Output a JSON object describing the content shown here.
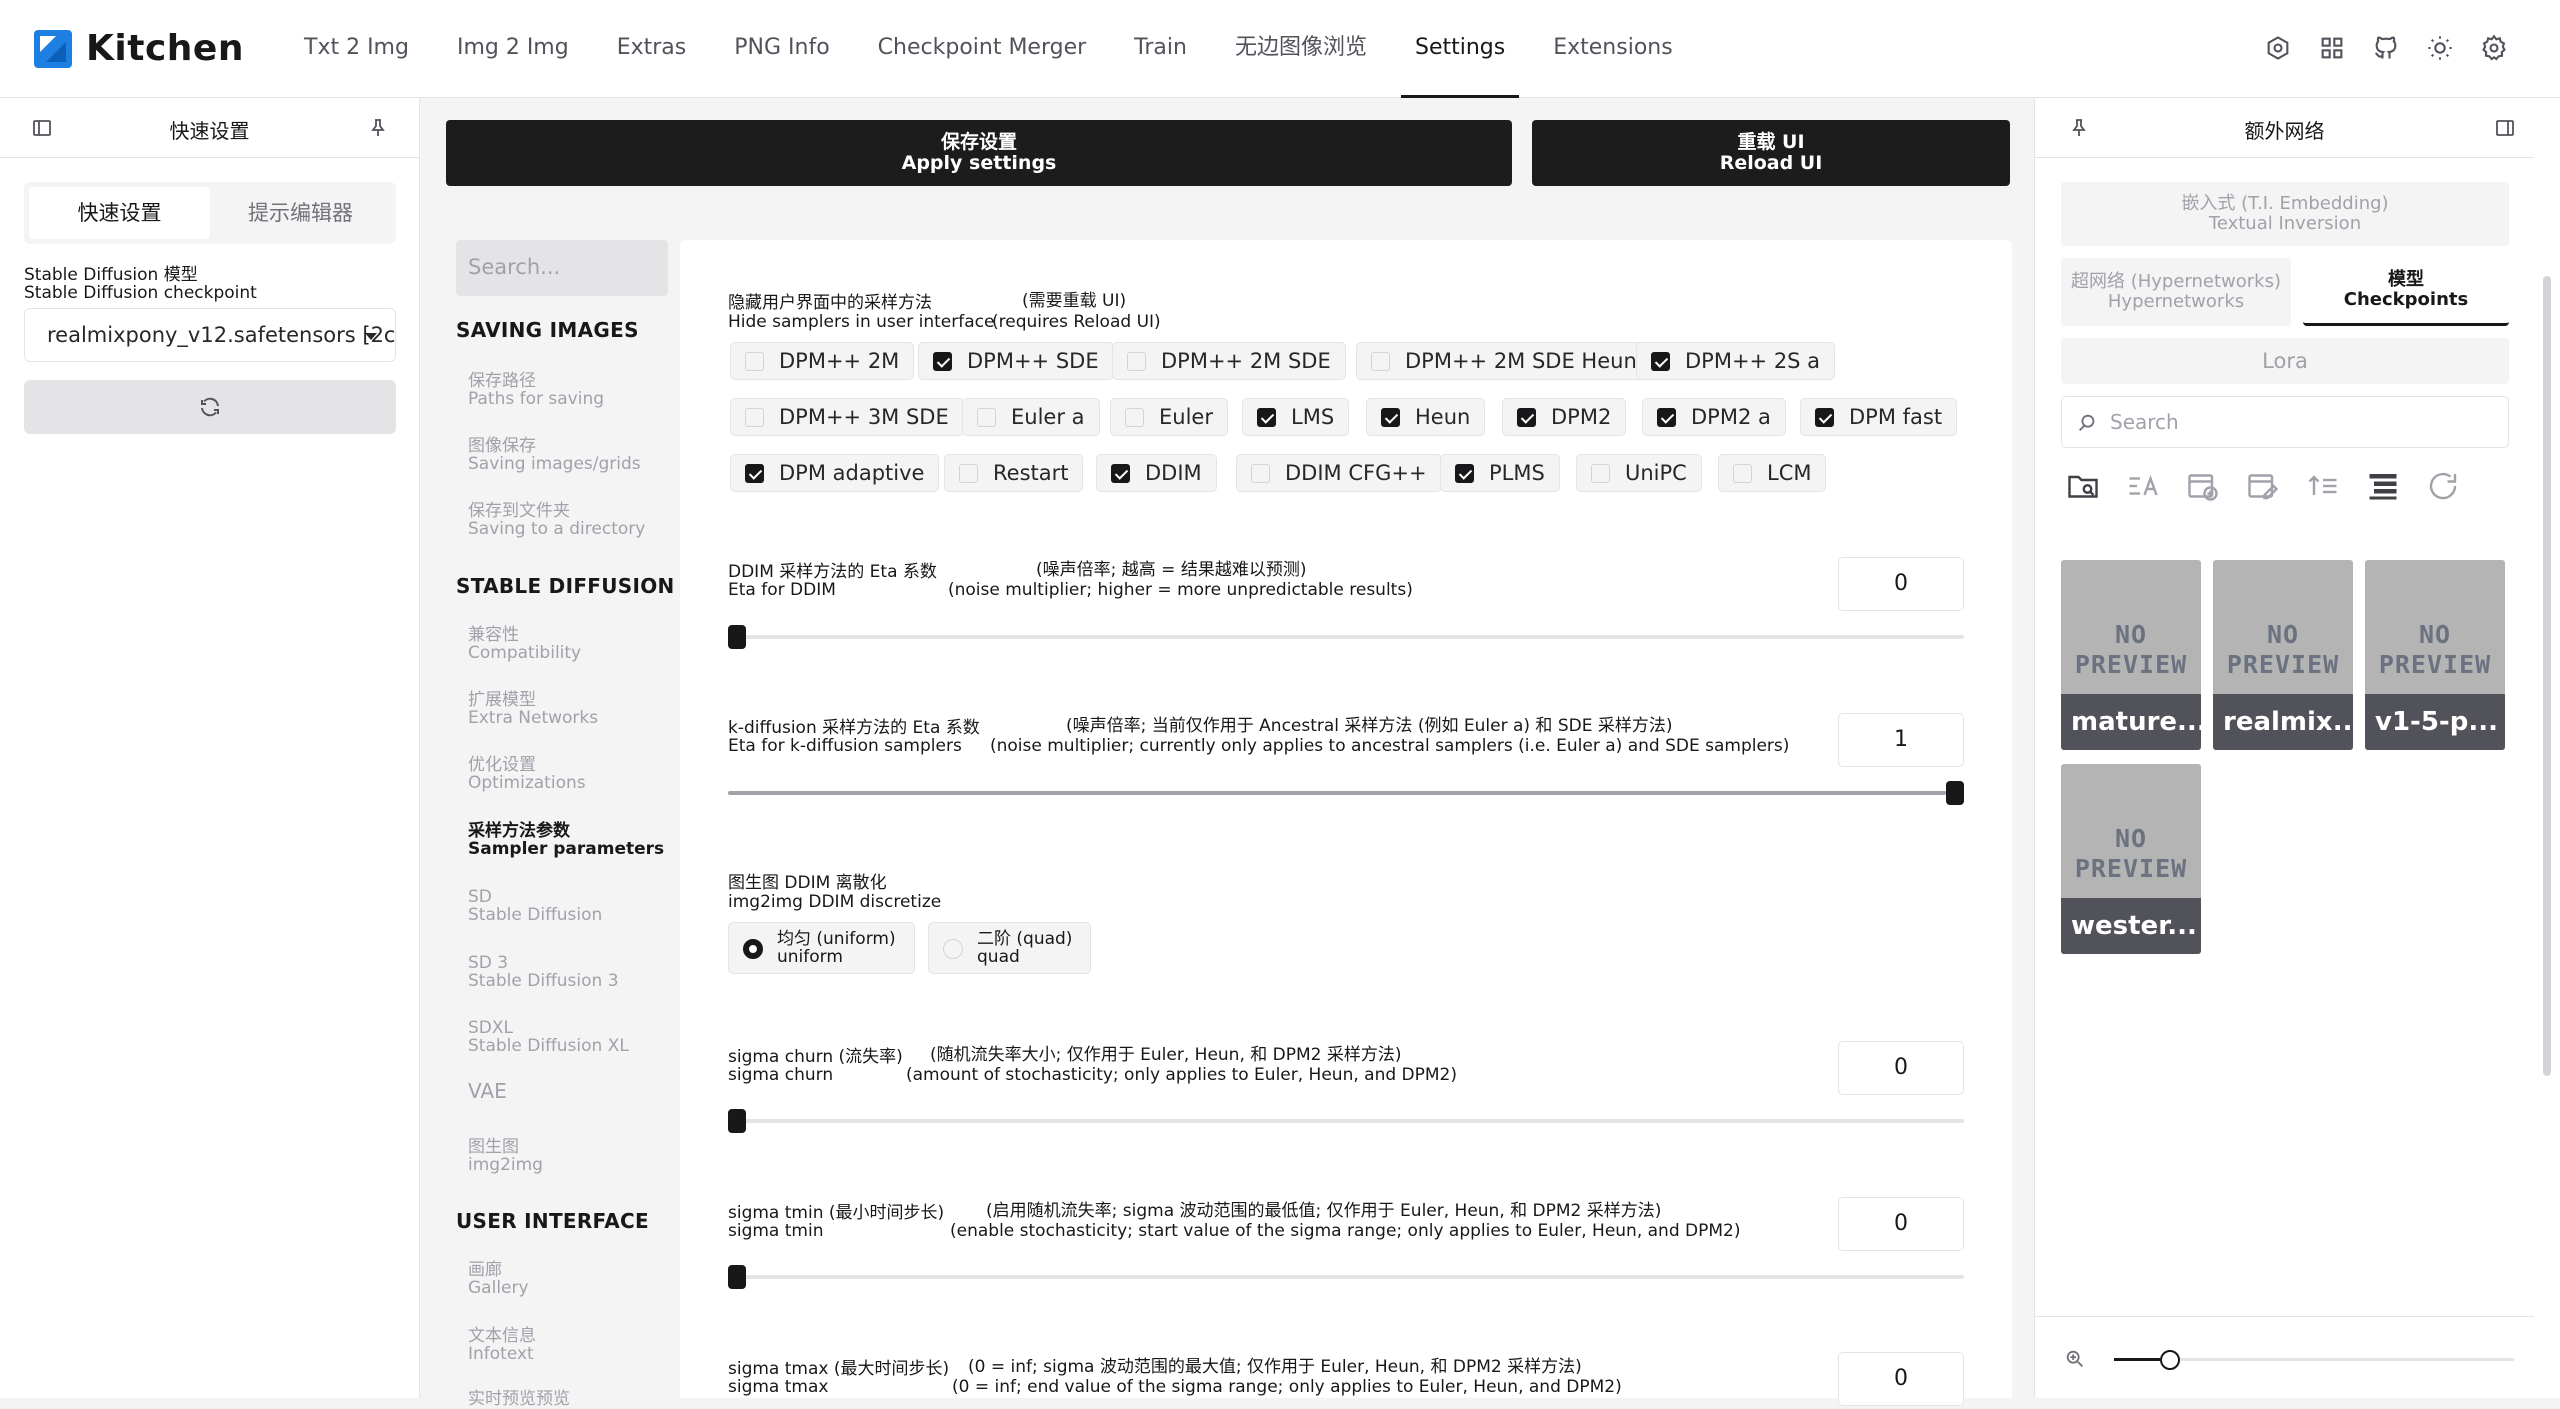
{
  "app": {
    "name": "Kitchen"
  },
  "nav": {
    "tabs": [
      "Txt 2 Img",
      "Img 2 Img",
      "Extras",
      "PNG Info",
      "Checkpoint Merger",
      "Train",
      "无边图像浏览",
      "Settings",
      "Extensions"
    ],
    "active": "Settings"
  },
  "top_icons": [
    "hexagon-icon",
    "grid-icon",
    "github-icon",
    "sun-icon",
    "gear-icon"
  ],
  "left_panel": {
    "title": "快速设置",
    "tabs": [
      "快速设置",
      "提示编辑器"
    ],
    "model_label_zh": "Stable Diffusion 模型",
    "model_label_en": "Stable Diffusion checkpoint",
    "model_value": "realmixpony_v12.safetensors [2c"
  },
  "actions": {
    "apply_zh": "保存设置",
    "apply_en": "Apply settings",
    "reload_zh": "重载 UI",
    "reload_en": "Reload UI"
  },
  "settings_nav": {
    "search_placeholder": "Search...",
    "sections": [
      {
        "title": "SAVING IMAGES",
        "items": [
          {
            "zh": "保存路径",
            "en": "Paths for saving"
          },
          {
            "zh": "图像保存",
            "en": "Saving images/grids"
          },
          {
            "zh": "保存到文件夹",
            "en": "Saving to a directory"
          }
        ]
      },
      {
        "title": "STABLE DIFFUSION",
        "items": [
          {
            "zh": "兼容性",
            "en": "Compatibility"
          },
          {
            "zh": "扩展模型",
            "en": "Extra Networks"
          },
          {
            "zh": "优化设置",
            "en": "Optimizations"
          },
          {
            "zh": "采样方法参数",
            "en": "Sampler parameters",
            "active": true
          },
          {
            "zh": "SD",
            "en": "Stable Diffusion"
          },
          {
            "zh": "SD 3",
            "en": "Stable Diffusion 3"
          },
          {
            "zh": "SDXL",
            "en": "Stable Diffusion XL"
          },
          {
            "zh": "VAE",
            "en": ""
          },
          {
            "zh": "图生图",
            "en": "img2img"
          }
        ]
      },
      {
        "title": "USER INTERFACE",
        "items": [
          {
            "zh": "画廊",
            "en": "Gallery"
          },
          {
            "zh": "文本信息",
            "en": "Infotext"
          },
          {
            "zh": "实时预览预览",
            "en": ""
          }
        ]
      }
    ]
  },
  "samplers": {
    "label_zh": "隐藏用户界面中的采样方法",
    "label_en": "Hide samplers in user interface",
    "note_zh": "(需要重载 UI)",
    "note_en": "(requires Reload UI)",
    "options": [
      {
        "name": "DPM++ 2M",
        "checked": false
      },
      {
        "name": "DPM++ SDE",
        "checked": true
      },
      {
        "name": "DPM++ 2M SDE",
        "checked": false
      },
      {
        "name": "DPM++ 2M SDE Heun",
        "checked": false
      },
      {
        "name": "DPM++ 2S a",
        "checked": true
      },
      {
        "name": "DPM++ 3M SDE",
        "checked": false
      },
      {
        "name": "Euler a",
        "checked": false
      },
      {
        "name": "Euler",
        "checked": false
      },
      {
        "name": "LMS",
        "checked": true
      },
      {
        "name": "Heun",
        "checked": true
      },
      {
        "name": "DPM2",
        "checked": true
      },
      {
        "name": "DPM2 a",
        "checked": true
      },
      {
        "name": "DPM fast",
        "checked": true
      },
      {
        "name": "DPM adaptive",
        "checked": true
      },
      {
        "name": "Restart",
        "checked": false
      },
      {
        "name": "DDIM",
        "checked": true
      },
      {
        "name": "DDIM CFG++",
        "checked": false
      },
      {
        "name": "PLMS",
        "checked": true
      },
      {
        "name": "UniPC",
        "checked": false
      },
      {
        "name": "LCM",
        "checked": false
      }
    ]
  },
  "eta_ddim": {
    "label_zh": "DDIM 采样方法的 Eta 系数",
    "label_en": "Eta for DDIM",
    "note_zh": "(噪声倍率; 越高 = 结果越难以预测)",
    "note_en": "(noise multiplier; higher = more unpredictable results)",
    "value": "0",
    "fraction": 0
  },
  "eta_k": {
    "label_zh": "k-diffusion 采样方法的 Eta 系数",
    "label_en": "Eta for k-diffusion samplers",
    "note_zh": "(噪声倍率; 当前仅作用于 Ancestral 采样方法 (例如 Euler a) 和 SDE 采样方法)",
    "note_en": "(noise multiplier; currently only applies to ancestral samplers (i.e. Euler a) and SDE samplers)",
    "value": "1",
    "fraction": 1
  },
  "discretize": {
    "label_zh": "图生图 DDIM 离散化",
    "label_en": "img2img DDIM discretize",
    "options": [
      {
        "zh": "均匀 (uniform)",
        "en": "uniform",
        "selected": true
      },
      {
        "zh": "二阶 (quad)",
        "en": "quad",
        "selected": false
      }
    ]
  },
  "sigma_churn": {
    "label_zh": "sigma churn (流失率)",
    "label_en": "sigma churn",
    "note_zh": "(随机流失率大小; 仅作用于 Euler, Heun, 和 DPM2 采样方法)",
    "note_en": "(amount of stochasticity; only applies to Euler, Heun, and DPM2)",
    "value": "0",
    "fraction": 0
  },
  "sigma_tmin": {
    "label_zh": "sigma tmin (最小时间步长)",
    "label_en": "sigma tmin",
    "note_zh": "(启用随机流失率; sigma 波动范围的最低值; 仅作用于 Euler, Heun, 和 DPM2 采样方法)",
    "note_en": "(enable stochasticity; start value of the sigma range; only applies to Euler, Heun, and DPM2)",
    "value": "0",
    "fraction": 0
  },
  "sigma_tmax": {
    "label_zh": "sigma tmax (最大时间步长)",
    "label_en": "sigma tmax",
    "note_zh": "(0 = inf; sigma 波动范围的最大值; 仅作用于 Euler, Heun, 和 DPM2 采样方法)",
    "note_en": "(0 = inf; end value of the sigma range; only applies to Euler, Heun, and DPM2)",
    "value": "0"
  },
  "right_panel": {
    "title": "额外网络",
    "tabs": [
      {
        "zh": "嵌入式 (T.I. Embedding)",
        "en": "Textual Inversion"
      },
      {
        "zh": "超网络 (Hypernetworks)",
        "en": "Hypernetworks"
      },
      {
        "zh": "模型",
        "en": "Checkpoints",
        "active": true
      },
      {
        "zh": "Lora",
        "en": ""
      }
    ],
    "search_placeholder": "Search",
    "tool_icons": [
      "folder-search-icon",
      "sort-alpha-icon",
      "calendar-add-icon",
      "calendar-edit-icon",
      "sort-asc-icon",
      "tree-view-icon",
      "refresh-icon"
    ],
    "cards": [
      {
        "label": "mature...",
        "preview": "NO PREVIEW"
      },
      {
        "label": "realmix...",
        "preview": "NO PREVIEW"
      },
      {
        "label": "v1-5-p...",
        "preview": "NO PREVIEW"
      },
      {
        "label": "wester...",
        "preview": "NO PREVIEW"
      }
    ],
    "zoom_fraction": 0.12
  }
}
